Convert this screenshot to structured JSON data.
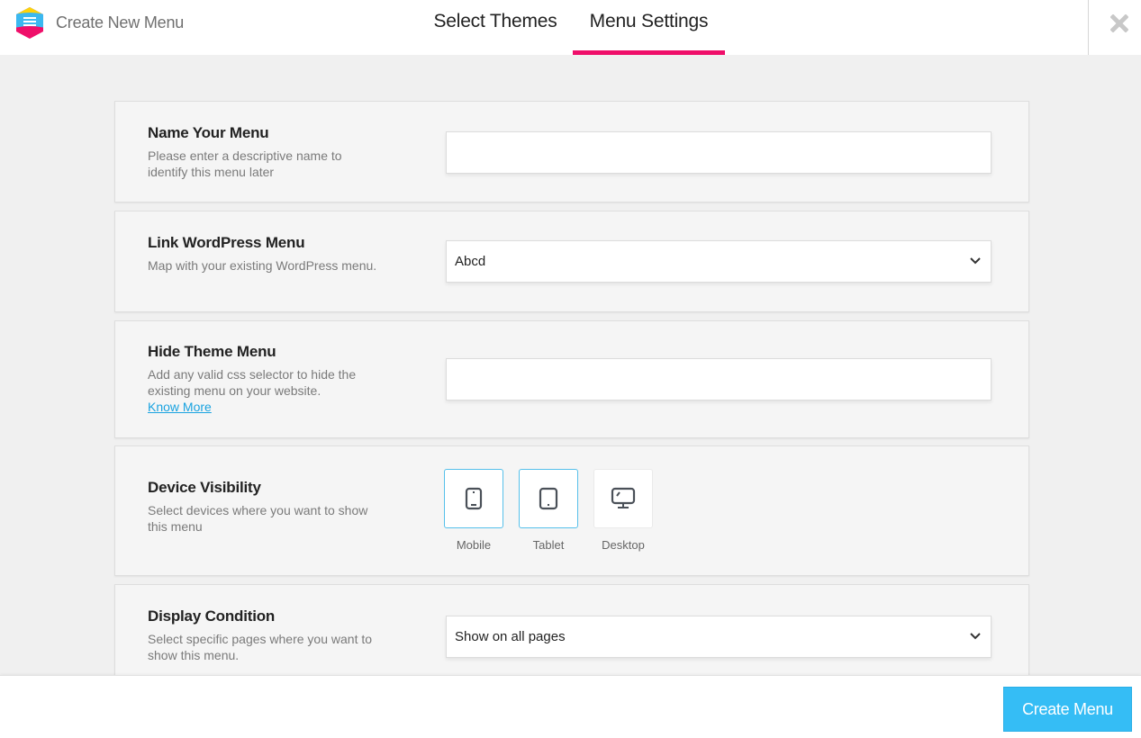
{
  "header": {
    "app_title": "Create New Menu",
    "tabs": [
      {
        "label": "Select Themes",
        "active": false
      },
      {
        "label": "Menu Settings",
        "active": true
      }
    ],
    "close_icon": "close-x-icon",
    "accent_color": "#ef0f6a"
  },
  "sections": {
    "name": {
      "title": "Name Your Menu",
      "description": "Please enter a descriptive name to identify this menu later",
      "value": "",
      "placeholder": ""
    },
    "link_wp": {
      "title": "Link WordPress Menu",
      "description": "Map with your existing WordPress menu.",
      "selected": "Abcd"
    },
    "hide_theme": {
      "title": "Hide Theme Menu",
      "description": "Add any valid css selector to hide the existing menu on your website.",
      "link_label": "Know More",
      "value": "",
      "placeholder": ""
    },
    "device_visibility": {
      "title": "Device Visibility",
      "description": "Select devices where you want to show this menu",
      "devices": [
        {
          "label": "Mobile",
          "icon": "mobile-icon",
          "selected": true
        },
        {
          "label": "Tablet",
          "icon": "tablet-icon",
          "selected": true
        },
        {
          "label": "Desktop",
          "icon": "desktop-icon",
          "selected": false
        }
      ]
    },
    "display_condition": {
      "title": "Display Condition",
      "description": "Select specific pages where you want to show this menu.",
      "selected": "Show on all pages"
    }
  },
  "footer": {
    "create_label": "Create Menu",
    "button_color": "#35bdf5"
  }
}
